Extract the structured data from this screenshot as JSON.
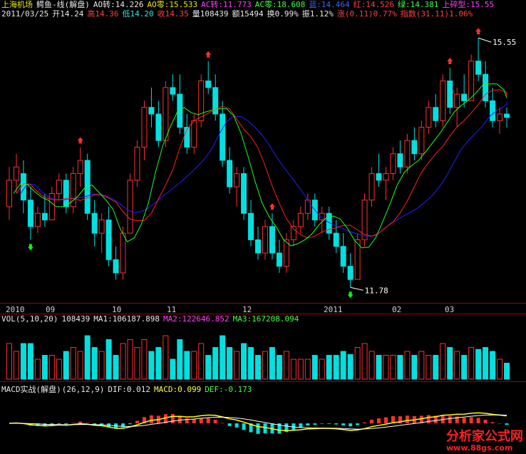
{
  "header": {
    "name": "上海机场",
    "indicator": "鳄鱼-线(解盘)",
    "ao_turn": "AO转:14.226",
    "ao_zero": "AO零:15.533",
    "ac_turn": "AC转:11.773",
    "ac_zero": "AC零:18.608",
    "blue": "蓝:14.464",
    "red": "红:14.526",
    "green": "绿:14.381",
    "top": "上碎型:15.55"
  },
  "quote": {
    "date": "2011/03/25",
    "open": "开14.24",
    "high": "高14.36",
    "low": "低14.20",
    "close": "收14.35",
    "volume": "量108439",
    "amount": "额15494",
    "turnover": "换0.99%",
    "amplitude": "振1.12%",
    "change": "涨(0.11)0.77%",
    "index": "指数(31.11)1.06%"
  },
  "price_marks": {
    "high": "15.55",
    "low": "11.78"
  },
  "x_axis": [
    "2010",
    "09",
    "10",
    "11",
    "12",
    "2011",
    "02",
    "03"
  ],
  "vol_header": {
    "title": "VOL(5,10,20)",
    "value": "108439",
    "ma1": "MA1:106187.898",
    "ma2": "MA2:122646.852",
    "ma3": "MA3:167208.094"
  },
  "macd_header": {
    "title": "MACD实战(解盘)",
    "params": "(26,12,9)",
    "dif": "DIF:0.012",
    "macd": "MACD:0.099",
    "def": "DEF:-0.173"
  },
  "watermark": {
    "brand": "分析家公式网",
    "url": "www.88gs.com"
  },
  "colors": {
    "up": "#ff3030",
    "down": "#00e0e0",
    "blue_line": "#2020ff",
    "red_line": "#ff2020",
    "green_line": "#20ff20",
    "yellow": "#ffff00",
    "magenta": "#ff00ff",
    "axis": "#a00000",
    "arrow_green": "#00ff00"
  },
  "chart_data": {
    "type": "candlestick",
    "ylim": [
      11.6,
      15.8
    ],
    "candles": [
      [
        13.0,
        13.6,
        12.8,
        13.4
      ],
      [
        13.4,
        13.8,
        13.2,
        13.6
      ],
      [
        13.5,
        13.7,
        12.9,
        13.1
      ],
      [
        13.1,
        13.3,
        12.5,
        12.7
      ],
      [
        12.7,
        13.0,
        12.6,
        12.9
      ],
      [
        12.9,
        13.2,
        12.7,
        12.8
      ],
      [
        12.8,
        13.3,
        12.8,
        13.2
      ],
      [
        13.2,
        13.5,
        13.1,
        13.4
      ],
      [
        13.4,
        13.5,
        12.9,
        13.0
      ],
      [
        13.0,
        13.6,
        12.9,
        13.5
      ],
      [
        13.5,
        13.9,
        13.3,
        13.7
      ],
      [
        13.7,
        13.8,
        12.8,
        12.9
      ],
      [
        12.9,
        13.1,
        12.4,
        12.6
      ],
      [
        12.6,
        12.9,
        12.3,
        12.8
      ],
      [
        12.8,
        13.0,
        12.1,
        12.2
      ],
      [
        12.2,
        12.4,
        11.9,
        12.0
      ],
      [
        12.0,
        12.7,
        11.9,
        12.6
      ],
      [
        12.6,
        13.5,
        12.6,
        13.4
      ],
      [
        13.4,
        14.0,
        13.3,
        13.9
      ],
      [
        13.9,
        14.6,
        13.7,
        14.5
      ],
      [
        14.5,
        14.8,
        14.2,
        14.4
      ],
      [
        14.4,
        14.6,
        13.9,
        14.0
      ],
      [
        14.0,
        14.9,
        13.9,
        14.8
      ],
      [
        14.8,
        15.0,
        14.6,
        14.7
      ],
      [
        14.7,
        15.0,
        14.1,
        14.2
      ],
      [
        14.2,
        14.4,
        13.8,
        13.9
      ],
      [
        13.9,
        14.4,
        13.8,
        14.3
      ],
      [
        14.3,
        15.0,
        14.2,
        14.9
      ],
      [
        14.9,
        15.2,
        14.7,
        14.8
      ],
      [
        14.8,
        15.0,
        14.3,
        14.4
      ],
      [
        14.4,
        14.6,
        13.6,
        13.7
      ],
      [
        13.7,
        13.9,
        13.2,
        13.3
      ],
      [
        13.3,
        13.6,
        13.0,
        13.5
      ],
      [
        13.5,
        13.6,
        12.8,
        12.9
      ],
      [
        12.9,
        13.1,
        12.4,
        12.5
      ],
      [
        12.5,
        12.7,
        12.2,
        12.3
      ],
      [
        12.3,
        12.8,
        12.2,
        12.7
      ],
      [
        12.7,
        12.9,
        12.2,
        12.3
      ],
      [
        12.3,
        12.5,
        12.0,
        12.1
      ],
      [
        12.1,
        12.6,
        12.0,
        12.5
      ],
      [
        12.5,
        12.8,
        12.4,
        12.7
      ],
      [
        12.7,
        13.0,
        12.6,
        12.9
      ],
      [
        12.9,
        13.2,
        12.8,
        13.1
      ],
      [
        13.1,
        13.2,
        12.7,
        12.8
      ],
      [
        12.8,
        13.0,
        12.6,
        12.9
      ],
      [
        12.9,
        13.0,
        12.5,
        12.6
      ],
      [
        12.6,
        12.8,
        12.3,
        12.4
      ],
      [
        12.4,
        12.6,
        12.0,
        12.1
      ],
      [
        12.1,
        12.3,
        11.78,
        11.9
      ],
      [
        11.9,
        12.6,
        11.9,
        12.5
      ],
      [
        12.5,
        13.2,
        12.4,
        13.1
      ],
      [
        13.1,
        13.6,
        13.0,
        13.5
      ],
      [
        13.5,
        13.8,
        13.3,
        13.4
      ],
      [
        13.4,
        13.6,
        13.1,
        13.5
      ],
      [
        13.5,
        13.9,
        13.4,
        13.8
      ],
      [
        13.8,
        14.0,
        13.5,
        13.6
      ],
      [
        13.6,
        14.1,
        13.5,
        14.0
      ],
      [
        14.0,
        14.2,
        13.7,
        13.8
      ],
      [
        13.8,
        14.3,
        13.7,
        14.2
      ],
      [
        14.2,
        14.6,
        14.1,
        14.5
      ],
      [
        14.5,
        14.7,
        14.2,
        14.3
      ],
      [
        14.3,
        15.0,
        14.2,
        14.9
      ],
      [
        14.9,
        15.1,
        14.4,
        14.5
      ],
      [
        14.5,
        14.8,
        14.2,
        14.7
      ],
      [
        14.7,
        15.0,
        14.5,
        14.6
      ],
      [
        14.6,
        15.3,
        14.6,
        15.2
      ],
      [
        15.2,
        15.55,
        14.9,
        15.0
      ],
      [
        15.0,
        15.2,
        14.5,
        14.6
      ],
      [
        14.6,
        14.8,
        14.2,
        14.3
      ],
      [
        14.3,
        14.5,
        14.1,
        14.4
      ],
      [
        14.4,
        14.5,
        14.2,
        14.35
      ]
    ]
  }
}
